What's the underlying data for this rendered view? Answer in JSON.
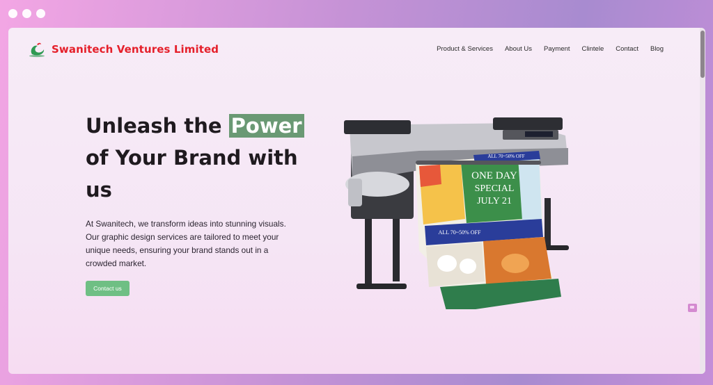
{
  "brand": {
    "name": "Swanitech Ventures Limited",
    "color": "#e5202b"
  },
  "nav": {
    "items": [
      {
        "label": "Product & Services"
      },
      {
        "label": "About Us"
      },
      {
        "label": "Payment"
      },
      {
        "label": "Clintele"
      },
      {
        "label": "Contact"
      },
      {
        "label": "Blog"
      }
    ]
  },
  "hero": {
    "title_pre": "Unleash the ",
    "title_highlight": "Power",
    "title_post": " of Your Brand with us",
    "description": "At Swanitech, we transform ideas into stunning visuals. Our graphic design services are tailored to meet your unique needs, ensuring your brand stands out in a crowded market.",
    "cta_label": "Contact us",
    "accent_color": "#6a9974"
  },
  "poster": {
    "line1": "ONE DAY",
    "line2": "SPECIAL",
    "line3": "JULY 21",
    "banner": "ALL 70~50% OFF"
  },
  "icons": [
    "window-dot-icon",
    "swan-logo-icon",
    "printer-image",
    "chat-icon"
  ]
}
